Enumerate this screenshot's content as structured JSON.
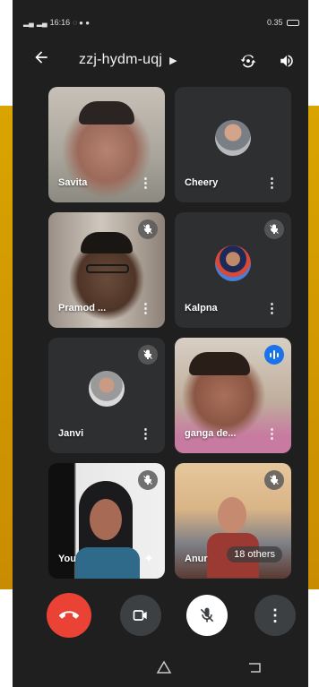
{
  "status": {
    "left": "16:16",
    "right": "0.35"
  },
  "meeting": {
    "code": "zzj-hydm-uqj"
  },
  "participants": [
    {
      "name": "Savita"
    },
    {
      "name": "Cheery"
    },
    {
      "name": "Pramod ..."
    },
    {
      "name": "Kalpna"
    },
    {
      "name": "Janvi"
    },
    {
      "name": "ganga de..."
    },
    {
      "name": "You"
    },
    {
      "name": "Anur"
    }
  ],
  "others_label": "18 others",
  "icons": {
    "back": "arrow-left-icon",
    "title_chevron": "chevron-right-icon",
    "switch_camera": "camera-switch-icon",
    "audio_output": "speaker-icon",
    "more": "more-vertical-icon",
    "muted": "mic-off-icon",
    "speaking": "audio-wave-icon",
    "end_call": "call-end-icon",
    "camera": "videocam-icon",
    "mute": "mic-off-icon",
    "options": "more-vertical-icon",
    "effects": "sparkle-icon",
    "nav_home": "home-icon",
    "nav_back": "back-icon"
  },
  "colors": {
    "end_call": "#ea4335",
    "speaking": "#1a73e8",
    "background": "#1f1f1f",
    "side_accent": "#d9a400"
  }
}
